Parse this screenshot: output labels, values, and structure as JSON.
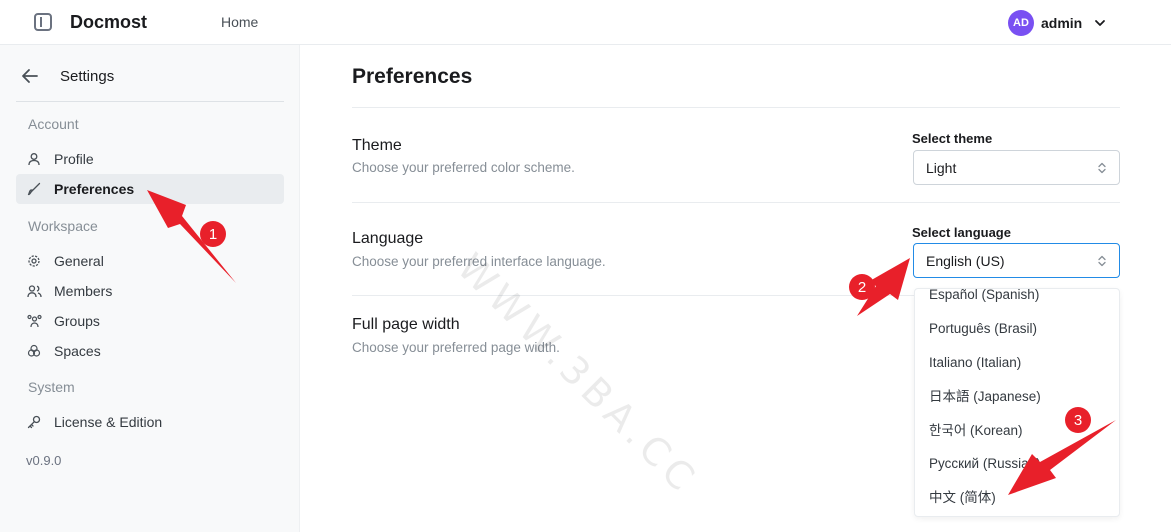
{
  "header": {
    "brand": "Docmost",
    "home_label": "Home",
    "user": {
      "initials": "AD",
      "name": "admin",
      "avatar_color": "#7950f2"
    }
  },
  "sidebar": {
    "title": "Settings",
    "sections": [
      {
        "label": "Account"
      },
      {
        "label": "Workspace"
      },
      {
        "label": "System"
      }
    ],
    "items": [
      {
        "label": "Profile",
        "icon": "user-icon",
        "active": false
      },
      {
        "label": "Preferences",
        "icon": "brush-icon",
        "active": true
      },
      {
        "label": "General",
        "icon": "gear-icon",
        "active": false
      },
      {
        "label": "Members",
        "icon": "users-icon",
        "active": false
      },
      {
        "label": "Groups",
        "icon": "group-icon",
        "active": false
      },
      {
        "label": "Spaces",
        "icon": "spaces-icon",
        "active": false
      },
      {
        "label": "License & Edition",
        "icon": "key-icon",
        "active": false
      }
    ],
    "version": "v0.9.0"
  },
  "main": {
    "title": "Preferences",
    "theme": {
      "title": "Theme",
      "description": "Choose your preferred color scheme.",
      "select_label": "Select theme",
      "value": "Light"
    },
    "language": {
      "title": "Language",
      "description": "Choose your preferred interface language.",
      "select_label": "Select language",
      "value": "English (US)",
      "options": [
        "Español (Spanish)",
        "Português (Brasil)",
        "Italiano (Italian)",
        "日本語 (Japanese)",
        "한국어 (Korean)",
        "Русский (Russian)",
        "中文 (简体)"
      ]
    },
    "page_width": {
      "title": "Full page width",
      "description": "Choose your preferred page width."
    }
  },
  "watermark": "WWW.3BA.CC",
  "annotations": {
    "color": "#e8202a",
    "badges": [
      "1",
      "2",
      "3"
    ]
  },
  "colors": {
    "accent": "#228be6",
    "active_bg": "#e9ecef"
  }
}
